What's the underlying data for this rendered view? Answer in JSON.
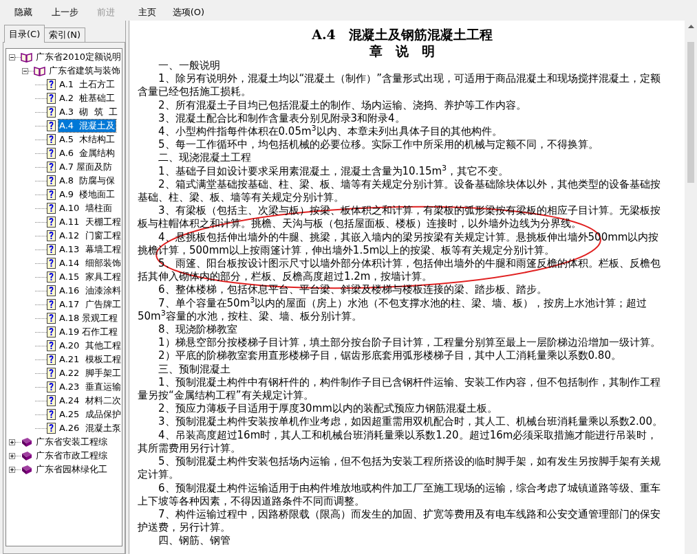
{
  "toolbar": [
    {
      "label": "隐藏",
      "disabled": false
    },
    {
      "label": "上一步",
      "disabled": false
    },
    {
      "label": "前进",
      "disabled": true
    },
    {
      "label": "主页",
      "disabled": false
    },
    {
      "label": "选项(O)",
      "disabled": false
    }
  ],
  "tabs": [
    {
      "label": "目录(C)",
      "selected": true
    },
    {
      "label": "索引(N)",
      "selected": false
    }
  ],
  "tree": [
    {
      "label": "广东省2010定额说明",
      "kind": "book",
      "expanded": true,
      "selected": false,
      "children": [
        {
          "label": "广东省建筑与装饰",
          "kind": "book",
          "expanded": true,
          "selected": false,
          "children": [
            {
              "label": "A.1  土石方工",
              "kind": "page",
              "selected": false
            },
            {
              "label": "A.2  桩基础工",
              "kind": "page",
              "selected": false
            },
            {
              "label": "A.3  砌  筑  工",
              "kind": "page",
              "selected": false
            },
            {
              "label": "A.4  混凝土及",
              "kind": "page",
              "selected": true
            },
            {
              "label": "A.5  木结构工",
              "kind": "page",
              "selected": false
            },
            {
              "label": "A.6  金属结构",
              "kind": "page",
              "selected": false
            },
            {
              "label": "A.7 屋面及防",
              "kind": "page",
              "selected": false
            },
            {
              "label": "A.8  防腐与保",
              "kind": "page",
              "selected": false
            },
            {
              "label": "A.9  楼地面工",
              "kind": "page",
              "selected": false
            },
            {
              "label": "A.10  墙柱面",
              "kind": "page",
              "selected": false
            },
            {
              "label": "A.11  天棚工程",
              "kind": "page",
              "selected": false
            },
            {
              "label": "A.12  门窗工程",
              "kind": "page",
              "selected": false
            },
            {
              "label": "A.13  幕墙工程",
              "kind": "page",
              "selected": false
            },
            {
              "label": "A.14  细部装饰",
              "kind": "page",
              "selected": false
            },
            {
              "label": "A.15  家具工程",
              "kind": "page",
              "selected": false
            },
            {
              "label": "A.16  油漆涂料",
              "kind": "page",
              "selected": false
            },
            {
              "label": "A.17  广告牌工",
              "kind": "page",
              "selected": false
            },
            {
              "label": "A.18 景观工程",
              "kind": "page",
              "selected": false
            },
            {
              "label": "A.19 石作工程",
              "kind": "page",
              "selected": false
            },
            {
              "label": "A.20  其他工程",
              "kind": "page",
              "selected": false
            },
            {
              "label": "A.21  模板工程",
              "kind": "page",
              "selected": false
            },
            {
              "label": "A.22  脚手架工",
              "kind": "page",
              "selected": false
            },
            {
              "label": "A.23  垂直运输",
              "kind": "page",
              "selected": false
            },
            {
              "label": "A.24  材料二次",
              "kind": "page",
              "selected": false
            },
            {
              "label": "A.25  成品保护",
              "kind": "page",
              "selected": false
            },
            {
              "label": "A.26  混凝土泵",
              "kind": "page",
              "selected": false
            }
          ]
        }
      ]
    },
    {
      "label": "广东省安装工程综",
      "kind": "book",
      "expanded": false,
      "selected": false
    },
    {
      "label": "广东省市政工程综",
      "kind": "book",
      "expanded": false,
      "selected": false
    },
    {
      "label": "广东省园林绿化工",
      "kind": "book",
      "expanded": false,
      "selected": false
    }
  ],
  "document": {
    "title": "A.4　混凝土及钢筋混凝土工程",
    "subtitle": "章　说　明",
    "paragraphs": [
      "一、一般说明",
      "1、除另有说明外，混凝土均以“混凝土（制作）”含量形式出现，可适用于商品混凝土和现场搅拌混凝土，定额含量已经包括施工损耗。",
      "2、所有混凝土子目均已包括混凝土的制作、场内运输、浇捣、养护等工作内容。",
      "3、混凝土配合比和制作含量表分别见附录3和附录4。",
      "4、小型构件指每件体积在0.05m$^{3}$以内、本章未列出具体子目的其他构件。",
      "5、每一工作循环中，均包括机械的必要位移。实际工作中所采用的机械与定额不同，不得换算。",
      "二、现浇混凝土工程",
      "1、基础子目如设计要求采用素混凝土，混凝土含量为10.15m$^{3}$，其它不变。",
      "2、箱式满堂基础按基础、柱、梁、板、墙等有关规定分别计算。设备基础除块体以外，其他类型的设备基础按基础、柱、梁、板、墙等有关规定分别计算。",
      "3、有梁板（包括主、次梁与板）按梁、板体积之和计算，有梁板的弧形梁按有梁板的相应子目计算。无梁板按板与柱帽体积之和计算。挑檐、天沟与板（包括屋面板、楼板）连接时，以外墙外边线为分界线。",
      "4、悬挑板包括伸出墙外的牛腿、挑梁，其嵌入墙内的梁另按梁有关规定计算。悬挑板伸出墙外500mm以内按挑檐计算，500mm以上按雨篷计算，伸出墙外1.5m以上的按梁、板等有关规定分别计算。",
      "5、雨篷、阳台板按设计图示尺寸以墙外部分体积计算，包括伸出墙外的牛腿和雨篷反檐的体积。栏板、反檐包括其伸入砌体内的部分，栏板、反檐高度超过1.2m，按墙计算。",
      "6、整体楼梯，包括休息平台、平台梁、斜梁及楼梯与楼板连接的梁、踏步板、踏步。",
      "7、单个容量在50m$^{3}$以内的屋面（房上）水池（不包支撑水池的柱、梁、墙、板），按房上水池计算；超过50m$^{3}$容量的水池，按柱、梁、墙、板分别计算。",
      "8、现浇阶梯教室",
      "1）梯悬空部分按楼梯子目计算，填土部分按台阶子目计算，工程量分别算至最上一层阶梯边沿增加一级计算。",
      "2）平底的阶梯教室套用直形楼梯子目，锯齿形底套用弧形楼梯子目，其中人工消耗量乘以系数0.80。",
      "三、预制混凝土",
      "1、预制混凝土构件中有钢杆件的，构件制作子目已含钢杆件运输、安装工作内容，但不包括制作，其制作工程量另按“金属结构工程”有关规定计算。",
      "2、预应力薄板子目适用于厚度30mm以内的装配式预应力钢筋混凝土板。",
      "3、预制混凝土构件安装按单机作业考虑，如因超重需用双机配合时，其人工、机械台班消耗量乘以系数2.00。",
      "4、吊装高度超过16m时，其人工和机械台班消耗量乘以系数1.20。超过16m必须采取措施才能进行吊装时，其所需费用另行计算。",
      "5、预制混凝土构件安装包括场内运输，但不包括为安装工程所搭设的临时脚手架，如有发生另按脚手架有关规定计算。",
      "6、预制混凝土构件运输适用于由构件堆放地或构件加工厂至施工现场的运输，综合考虑了城镇道路等级、重车上下坡等各种因素，不得因道路条件不同而调整。",
      "7、构件运输过程中，因路桥限载（限高）而发生的加固、扩宽等费用及有电车线路和公安交通管理部门的保安护送费，另行计算。",
      "四、钢筋、钢管"
    ]
  }
}
